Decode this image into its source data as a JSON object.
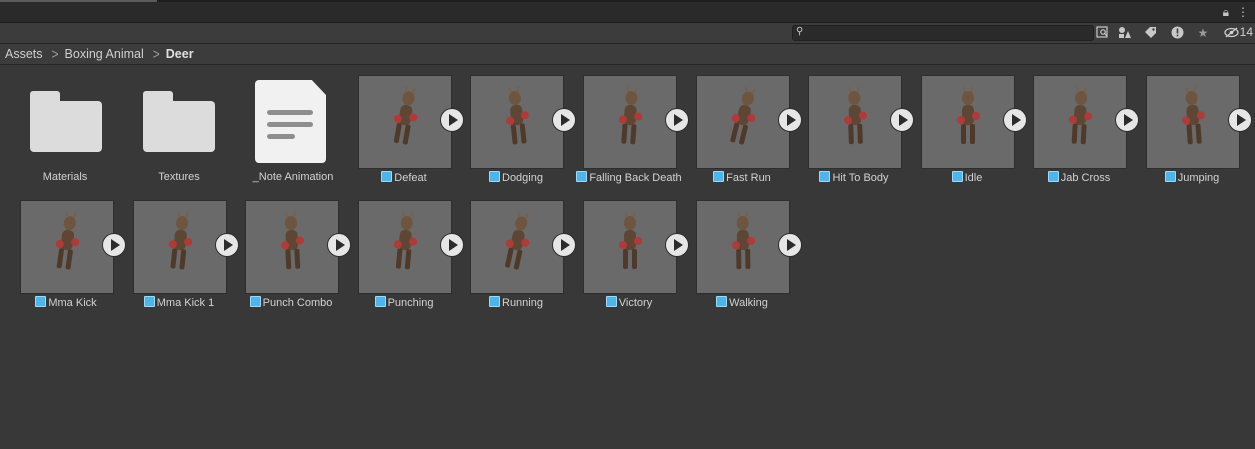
{
  "toolbar": {
    "hidden_count": "14",
    "icons": [
      "lock-icon",
      "kebab-menu-icon",
      "search-icon",
      "search-by-type-icon",
      "filter-by-label-icon",
      "log-icon",
      "favorite-star-icon",
      "hidden-eye-icon"
    ]
  },
  "breadcrumb": {
    "items": [
      "Assets",
      "Boxing Animal",
      "Deer"
    ]
  },
  "assets": [
    {
      "name": "Materials",
      "type": "folder"
    },
    {
      "name": "Textures",
      "type": "folder"
    },
    {
      "name": "_Note Animation",
      "type": "document"
    },
    {
      "name": "Defeat",
      "type": "model"
    },
    {
      "name": "Dodging",
      "type": "model"
    },
    {
      "name": "Falling Back Death",
      "type": "model"
    },
    {
      "name": "Fast Run",
      "type": "model"
    },
    {
      "name": "Hit To Body",
      "type": "model"
    },
    {
      "name": "Idle",
      "type": "model"
    },
    {
      "name": "Jab Cross",
      "type": "model"
    },
    {
      "name": "Jumping",
      "type": "model"
    },
    {
      "name": "Mma Kick",
      "type": "model"
    },
    {
      "name": "Mma Kick 1",
      "type": "model"
    },
    {
      "name": "Punch Combo",
      "type": "model"
    },
    {
      "name": "Punching",
      "type": "model"
    },
    {
      "name": "Running",
      "type": "model"
    },
    {
      "name": "Victory",
      "type": "model"
    },
    {
      "name": "Walking",
      "type": "model"
    }
  ],
  "colors": {
    "background": "#383838",
    "thumbnail": "#6a6a6a",
    "model_icon": "#4fb5e8"
  }
}
